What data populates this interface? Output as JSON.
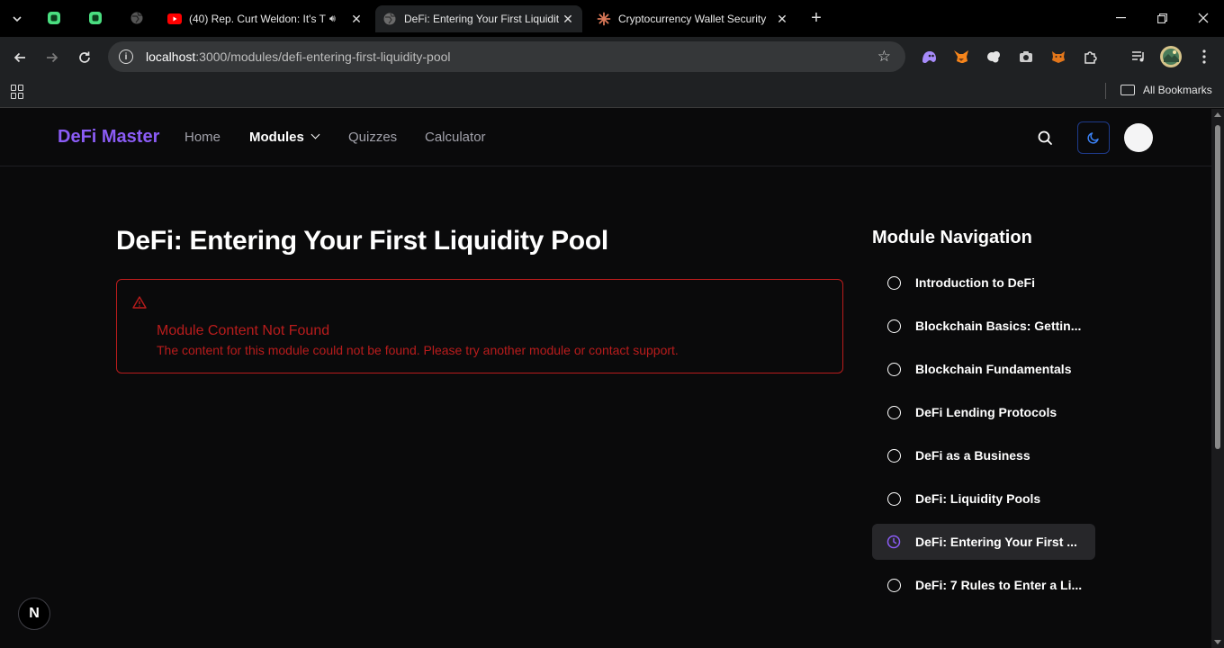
{
  "browser": {
    "tabs": [
      {
        "title": "(40) Rep. Curt Weldon: It's T",
        "favicon": "youtube-icon",
        "audio": true
      },
      {
        "title": "DeFi: Entering Your First Liquidit",
        "favicon": "globe-icon",
        "active": true
      },
      {
        "title": "Cryptocurrency Wallet Security",
        "favicon": "claude-icon"
      }
    ],
    "url_host": "localhost",
    "url_path": ":3000/modules/defi-entering-first-liquidity-pool",
    "bookmarks_label": "All Bookmarks"
  },
  "site": {
    "brand": "DeFi Master",
    "nav": {
      "home": "Home",
      "modules": "Modules",
      "quizzes": "Quizzes",
      "calculator": "Calculator"
    },
    "accent": "#8b5cf6"
  },
  "main": {
    "title": "DeFi: Entering Your First Liquidity Pool",
    "alert": {
      "title": "Module Content Not Found",
      "description": "The content for this module could not be found. Please try another module or contact support.",
      "color": "#b91c1c"
    }
  },
  "sidebar": {
    "title": "Module Navigation",
    "items": [
      {
        "label": "Introduction to DeFi",
        "status": "not-started"
      },
      {
        "label": "Blockchain Basics: Gettin...",
        "status": "not-started"
      },
      {
        "label": "Blockchain Fundamentals",
        "status": "not-started"
      },
      {
        "label": "DeFi Lending Protocols",
        "status": "not-started"
      },
      {
        "label": "DeFi as a Business",
        "status": "not-started"
      },
      {
        "label": "DeFi: Liquidity Pools",
        "status": "not-started"
      },
      {
        "label": "DeFi: Entering Your First ...",
        "status": "in-progress",
        "current": true
      },
      {
        "label": "DeFi: 7 Rules to Enter a Li...",
        "status": "not-started"
      }
    ]
  },
  "dev_badge": "N"
}
